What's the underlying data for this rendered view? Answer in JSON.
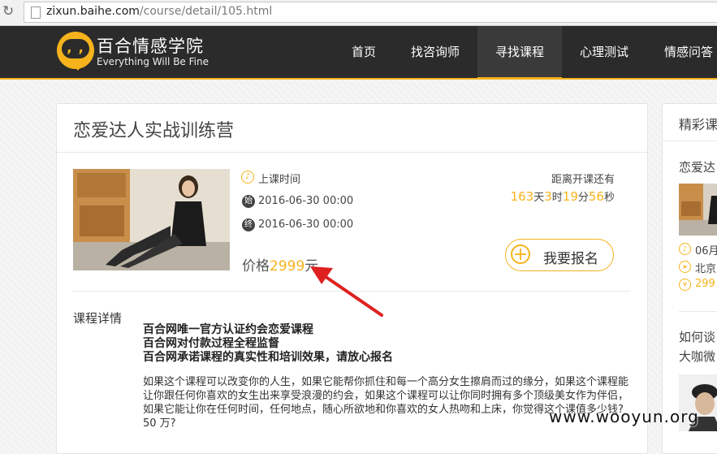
{
  "browser": {
    "url_host": "zixun.baihe.com",
    "url_path": "/course/detail/105.html"
  },
  "nav": {
    "logo_title": "百合情感学院",
    "logo_sub": "Everything Will Be Fine",
    "items": [
      "首页",
      "找咨询师",
      "寻找课程",
      "心理测试",
      "情感问答"
    ],
    "active_index": 2
  },
  "course": {
    "title": "恋爱达人实战训练营",
    "class_time_label": "上课时间",
    "start_badge": "始",
    "start": "2016-06-30 00:00",
    "end_badge": "终",
    "end": "2016-06-30 00:00",
    "price_label": "价格",
    "price": "2999",
    "price_unit": "元",
    "countdown_label": "距离开课还有",
    "countdown": {
      "days": "163",
      "days_unit": "天",
      "hours": "3",
      "hours_unit": "时",
      "minutes": "19",
      "minutes_unit": "分",
      "seconds": "56",
      "seconds_unit": "秒"
    },
    "enroll_label": "我要报名",
    "detail_label": "课程详情",
    "highlights": [
      "百合网唯一官方认证约会恋爱课程",
      "百合网对付款过程全程监督",
      "百合网承诺课程的真实性和培训效果，请放心报名"
    ],
    "description": "如果这个课程可以改变你的人生，如果它能帮你抓住和每一个高分女生擦肩而过的缘分，如果这个课程能让你跟任何你喜欢的女生出来享受浪漫的约会，如果这个课程可以让你同时拥有多个顶级美女作为伴侣，如果它能让你在任何时间，任何地点，随心所欲地和你喜欢的女人热吻和上床，你觉得这个课值多少钱?",
    "answer": "50 万?"
  },
  "side": {
    "title": "精彩课",
    "course_name": "恋爱达",
    "row1": "06月",
    "row2": "北京",
    "row3": "299",
    "question_line1": "如何谈",
    "question_line2": "大咖微"
  },
  "watermark": "www.wooyun.org",
  "colors": {
    "accent": "#f6b31c",
    "nav_bg": "#2b2b2b",
    "arrow": "#e02020"
  }
}
